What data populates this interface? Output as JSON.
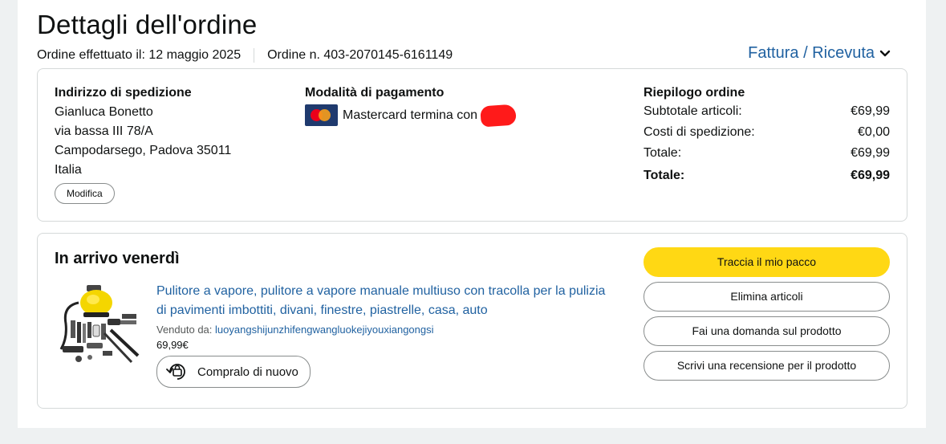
{
  "page_title": "Dettagli dell'ordine",
  "order_meta": {
    "placed": "Ordine effettuato il: 12 maggio 2025",
    "number": "Ordine n. 403-2070145-6161149"
  },
  "invoice_link": "Fattura / Ricevuta",
  "shipping": {
    "heading": "Indirizzo di spedizione",
    "name": "Gianluca Bonetto",
    "street": "via bassa III 78/A",
    "city": "Campodarsego, Padova 35011",
    "country": "Italia",
    "edit_label": "Modifica"
  },
  "payment": {
    "heading": "Modalità di pagamento",
    "method": "Mastercard termina con"
  },
  "summary": {
    "heading": "Riepilogo ordine",
    "rows": [
      {
        "label": "Subtotale articoli:",
        "value": "€69,99"
      },
      {
        "label": "Costi di spedizione:",
        "value": "€0,00"
      },
      {
        "label": "Totale:",
        "value": "€69,99"
      }
    ],
    "total": {
      "label": "Totale:",
      "value": "€69,99"
    }
  },
  "shipment": {
    "arrival": "In arrivo venerdì",
    "product_title": "Pulitore a vapore, pulitore a vapore manuale multiuso con tracolla per la pulizia di pavimenti imbottiti, divani, finestre, piastrelle, casa, auto",
    "sold_by_label": "Venduto da:",
    "seller": "luoyangshijunzhifengwangluokejiyouxiangongsi",
    "price": "69,99€",
    "buy_again": "Compralo di nuovo",
    "actions": {
      "track": "Traccia il mio pacco",
      "delete": "Elimina articoli",
      "question": "Fai una domanda sul prodotto",
      "review": "Scrivi una recensione per il prodotto"
    }
  },
  "colors": {
    "link": "#2162a1",
    "primary_button": "#ffd814",
    "redaction": "#ff1a1a"
  }
}
